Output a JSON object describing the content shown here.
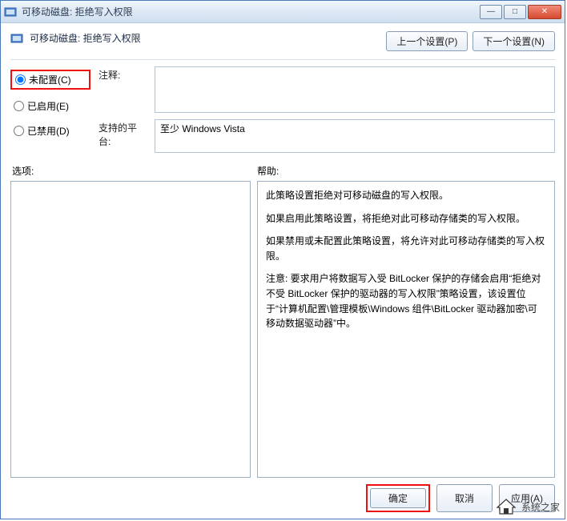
{
  "window": {
    "title": "可移动磁盘: 拒绝写入权限"
  },
  "header": {
    "title": "可移动磁盘: 拒绝写入权限",
    "prev_btn": "上一个设置(P)",
    "next_btn": "下一个设置(N)"
  },
  "radios": {
    "not_configured": "未配置(C)",
    "enabled": "已启用(E)",
    "disabled": "已禁用(D)",
    "selected": "not_configured"
  },
  "labels": {
    "comment": "注释:",
    "platform": "支持的平台:",
    "options": "选项:",
    "help": "帮助:"
  },
  "fields": {
    "comment_value": "",
    "platform_value": "至少 Windows Vista"
  },
  "help": {
    "p1": "此策略设置拒绝对可移动磁盘的写入权限。",
    "p2": "如果启用此策略设置，将拒绝对此可移动存储类的写入权限。",
    "p3": "如果禁用或未配置此策略设置，将允许对此可移动存储类的写入权限。",
    "p4": "注意: 要求用户将数据写入受 BitLocker 保护的存储会启用“拒绝对不受 BitLocker 保护的驱动器的写入权限”策略设置，该设置位于“计算机配置\\管理模板\\Windows 组件\\BitLocker 驱动器加密\\可移动数据驱动器”中。"
  },
  "footer": {
    "ok": "确定",
    "cancel": "取消",
    "apply": "应用(A)"
  },
  "watermark": {
    "text": "系统之家"
  }
}
